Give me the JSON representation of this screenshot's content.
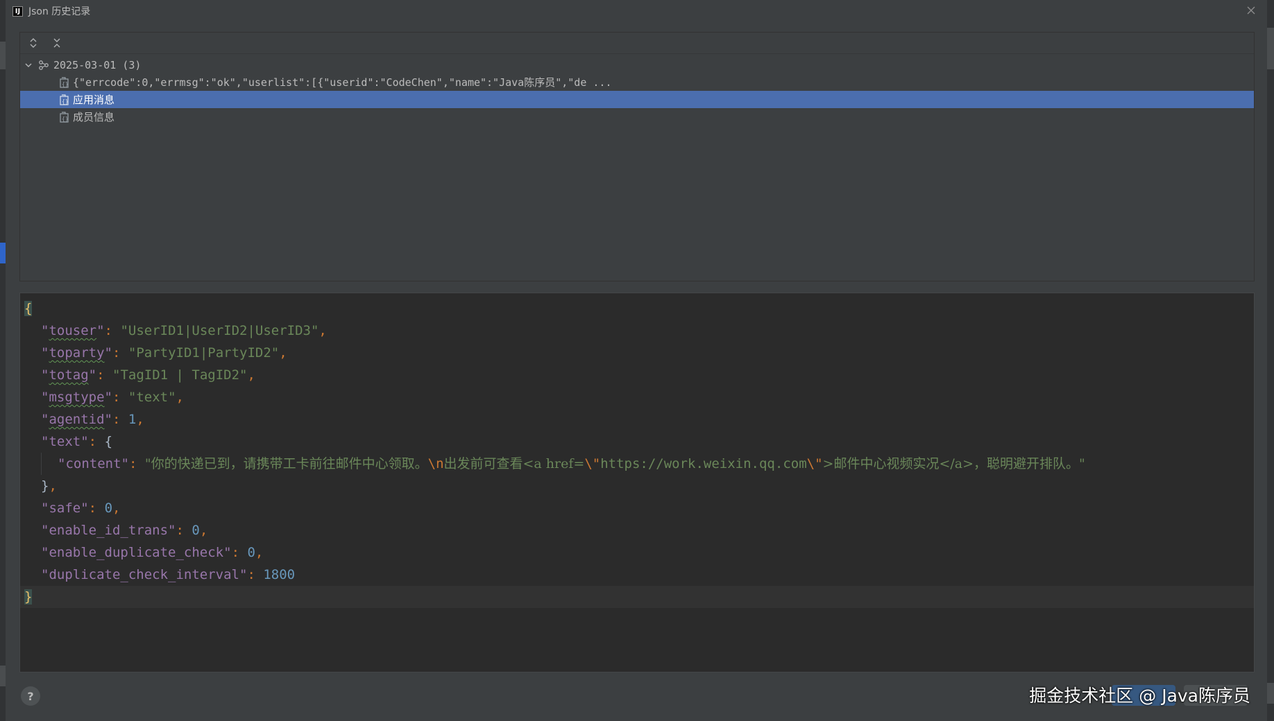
{
  "window": {
    "app_icon": "intellij-logo-icon",
    "app_icon_text": "IJ",
    "title": "Json 历史记录"
  },
  "toolbar": {
    "expand_all_icon": "expand-all-icon",
    "collapse_all_icon": "collapse-all-icon"
  },
  "tree": {
    "group": {
      "label": "2025-03-01 (3)",
      "expanded": true
    },
    "items": [
      {
        "label": "{\"errcode\":0,\"errmsg\":\"ok\",\"userlist\":[{\"userid\":\"CodeChen\",\"name\":\"Java陈序员\",\"de ...",
        "selected": false
      },
      {
        "label": "应用消息",
        "selected": true
      },
      {
        "label": "成员信息",
        "selected": false
      }
    ]
  },
  "editor": {
    "open_brace": "{",
    "close_brace": "}",
    "fields": {
      "touser": {
        "key": "touser",
        "value": "\"UserID1|UserID2|UserID3\""
      },
      "toparty": {
        "key": "toparty",
        "value": "\"PartyID1|PartyID2\""
      },
      "totag": {
        "key": "totag",
        "value": "\"TagID1 | TagID2\""
      },
      "msgtype": {
        "key": "msgtype",
        "value": "\"text\""
      },
      "agentid": {
        "key": "agentid",
        "value": "1"
      },
      "text": {
        "key": "text"
      },
      "content": {
        "key": "content",
        "part1": "\"你的快递已到，请携带工卡前往邮件中心领取。",
        "escape_n": "\\n",
        "part2": "出发前可查看<a href=",
        "escape_q1": "\\\"",
        "url": "https://work.weixin.qq.com",
        "escape_q2": "\\\"",
        "part3": ">邮件中心视频实况</a>，聪明避开排队。\""
      },
      "safe": {
        "key": "safe",
        "value": "0"
      },
      "enable_id_trans": {
        "key": "enable_id_trans",
        "value": "0"
      },
      "enable_duplicate_check": {
        "key": "enable_duplicate_check",
        "value": "0"
      },
      "duplicate_check_interval": {
        "key": "duplicate_check_interval",
        "value": "1800"
      }
    }
  },
  "footer": {
    "help_label": "?",
    "watermark": "掘金技术社区 @ Java陈序员"
  },
  "colors": {
    "background": "#3c3f41",
    "editor_background": "#2b2b2b",
    "selection": "#4b6eaf",
    "key": "#9876aa",
    "string": "#6a8759",
    "number": "#6897bb",
    "punctuation": "#cc7832",
    "brace": "#e8bf6a"
  }
}
